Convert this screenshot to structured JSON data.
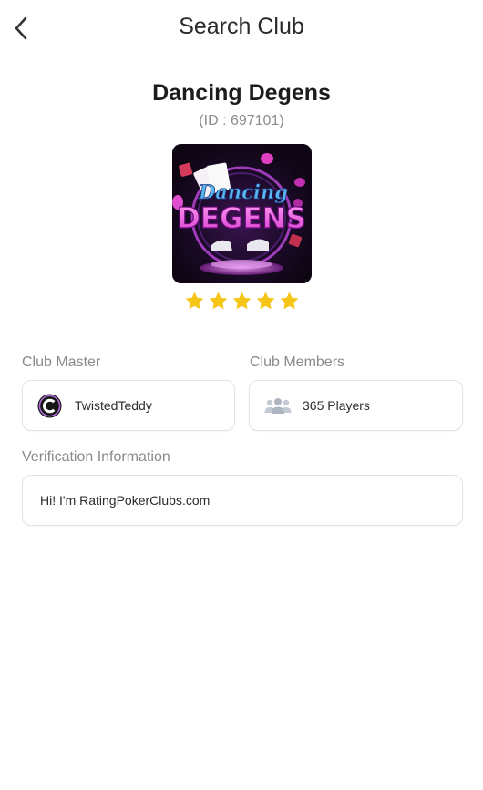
{
  "header": {
    "title": "Search Club",
    "back_icon": "chevron-left-icon"
  },
  "club": {
    "name": "Dancing Degens",
    "id_text": "(ID : 697101)",
    "logo_text_top": "Dancing",
    "logo_text_bottom": "DEGENS",
    "rating": 5,
    "rating_max": 5
  },
  "master": {
    "label": "Club Master",
    "name": "TwistedTeddy",
    "avatar_icon": "club-master-avatar"
  },
  "members": {
    "label": "Club Members",
    "count_text": "365 Players",
    "icon": "people-icon"
  },
  "verification": {
    "label": "Verification Information",
    "text": "Hi! I'm RatingPokerClubs.com"
  },
  "colors": {
    "star": "#F5C518",
    "label": "#8a8a8a",
    "border": "#e3e3e3"
  }
}
